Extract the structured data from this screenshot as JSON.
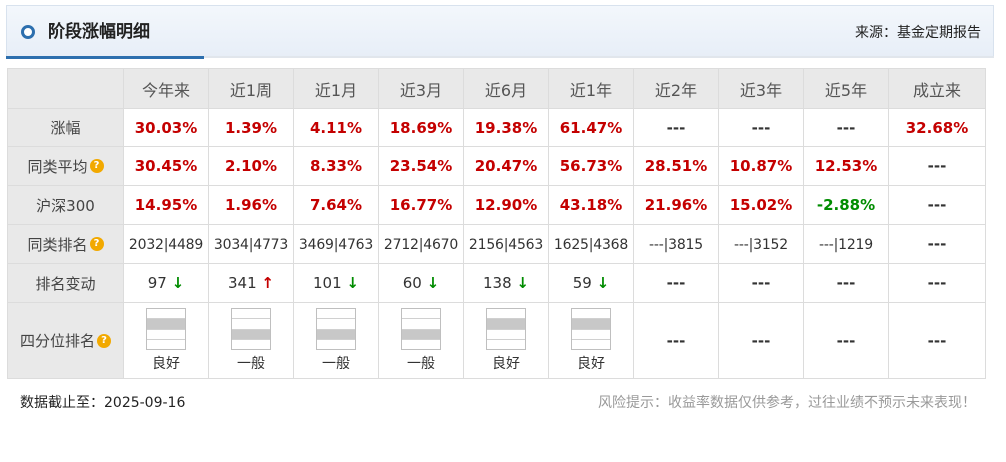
{
  "header": {
    "title": "阶段涨幅明细",
    "source": "来源：基金定期报告"
  },
  "columns": [
    "今年来",
    "近1周",
    "近1月",
    "近3月",
    "近6月",
    "近1年",
    "近2年",
    "近3年",
    "近5年",
    "成立来"
  ],
  "rows": {
    "gain": {
      "label": "涨幅",
      "cells": [
        {
          "text": "30.03%",
          "tone": "red"
        },
        {
          "text": "1.39%",
          "tone": "red"
        },
        {
          "text": "4.11%",
          "tone": "red"
        },
        {
          "text": "18.69%",
          "tone": "red"
        },
        {
          "text": "19.38%",
          "tone": "red"
        },
        {
          "text": "61.47%",
          "tone": "red"
        },
        {
          "text": "---",
          "tone": "dash"
        },
        {
          "text": "---",
          "tone": "dash"
        },
        {
          "text": "---",
          "tone": "dash"
        },
        {
          "text": "32.68%",
          "tone": "red"
        }
      ]
    },
    "peer_avg": {
      "label": "同类平均",
      "help": "?",
      "cells": [
        {
          "text": "30.45%",
          "tone": "red"
        },
        {
          "text": "2.10%",
          "tone": "red"
        },
        {
          "text": "8.33%",
          "tone": "red"
        },
        {
          "text": "23.54%",
          "tone": "red"
        },
        {
          "text": "20.47%",
          "tone": "red"
        },
        {
          "text": "56.73%",
          "tone": "red"
        },
        {
          "text": "28.51%",
          "tone": "red"
        },
        {
          "text": "10.87%",
          "tone": "red"
        },
        {
          "text": "12.53%",
          "tone": "red"
        },
        {
          "text": "---",
          "tone": "dash"
        }
      ]
    },
    "hs300": {
      "label": "沪深300",
      "cells": [
        {
          "text": "14.95%",
          "tone": "red"
        },
        {
          "text": "1.96%",
          "tone": "red"
        },
        {
          "text": "7.64%",
          "tone": "red"
        },
        {
          "text": "16.77%",
          "tone": "red"
        },
        {
          "text": "12.90%",
          "tone": "red"
        },
        {
          "text": "43.18%",
          "tone": "red"
        },
        {
          "text": "21.96%",
          "tone": "red"
        },
        {
          "text": "15.02%",
          "tone": "red"
        },
        {
          "text": "-2.88%",
          "tone": "green"
        },
        {
          "text": "---",
          "tone": "dash"
        }
      ]
    },
    "peer_rank": {
      "label": "同类排名",
      "help": "?",
      "cells": [
        "2032|4489",
        "3034|4773",
        "3469|4763",
        "2712|4670",
        "2156|4563",
        "1625|4368",
        "---|3815",
        "---|3152",
        "---|1219",
        "---"
      ]
    },
    "rank_change": {
      "label": "排名变动",
      "cells": [
        {
          "value": "97",
          "arrow": "↓",
          "dir": "down"
        },
        {
          "value": "341",
          "arrow": "↑",
          "dir": "up"
        },
        {
          "value": "101",
          "arrow": "↓",
          "dir": "down"
        },
        {
          "value": "60",
          "arrow": "↓",
          "dir": "down"
        },
        {
          "value": "138",
          "arrow": "↓",
          "dir": "down"
        },
        {
          "value": "59",
          "arrow": "↓",
          "dir": "down"
        },
        {
          "value": "---"
        },
        {
          "value": "---"
        },
        {
          "value": "---"
        },
        {
          "value": "---"
        }
      ]
    },
    "quartile": {
      "label": "四分位排名",
      "help": "?",
      "cells": [
        {
          "quartile": 2,
          "text": "良好"
        },
        {
          "quartile": 3,
          "text": "一般"
        },
        {
          "quartile": 3,
          "text": "一般"
        },
        {
          "quartile": 3,
          "text": "一般"
        },
        {
          "quartile": 2,
          "text": "良好"
        },
        {
          "quartile": 2,
          "text": "良好"
        },
        {
          "text": "---"
        },
        {
          "text": "---"
        },
        {
          "text": "---"
        },
        {
          "text": "---"
        }
      ]
    }
  },
  "footer": {
    "date": "数据截止至：2025-09-16",
    "risk": "风险提示：收益率数据仅供参考，过往业绩不预示未来表现！"
  },
  "colors": {
    "positive": "#c40000",
    "negative": "#008c00",
    "accent": "#2d6fae",
    "help_icon": "#f2a900"
  }
}
